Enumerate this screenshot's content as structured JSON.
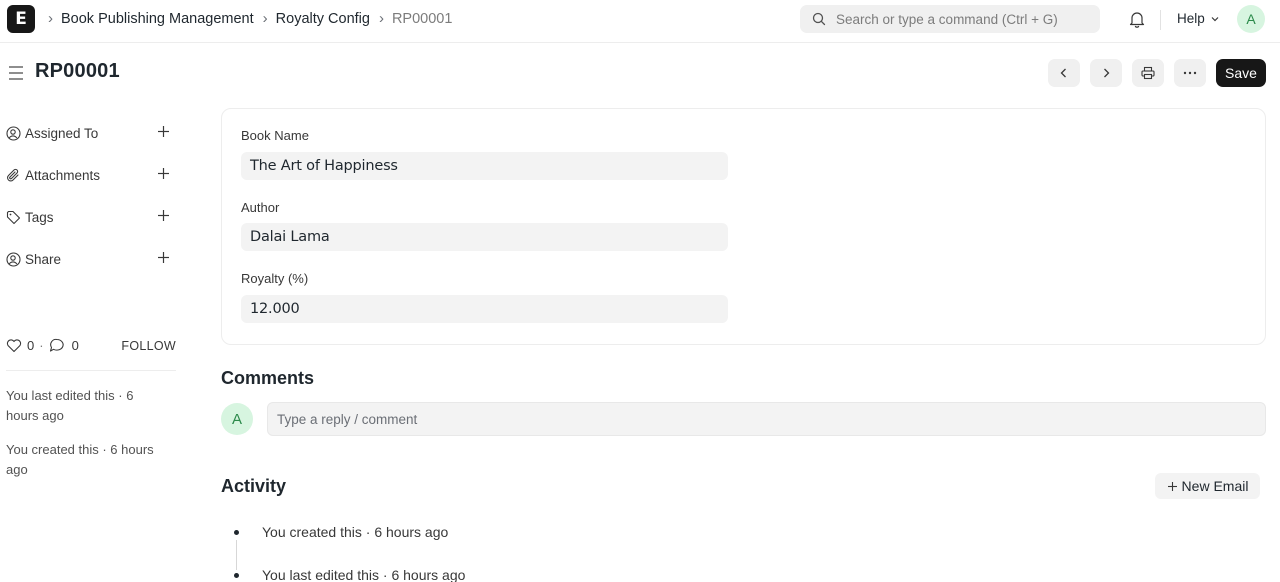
{
  "navbar": {
    "logo_letter": "E",
    "breadcrumbs": [
      "Book Publishing Management",
      "Royalty Config",
      "RP00001"
    ],
    "search_placeholder": "Search or type a command (Ctrl + G)",
    "help_label": "Help",
    "avatar_letter": "A"
  },
  "header": {
    "title": "RP00001",
    "save_label": "Save"
  },
  "sidebar": {
    "items": [
      {
        "label": "Assigned To"
      },
      {
        "label": "Attachments"
      },
      {
        "label": "Tags"
      },
      {
        "label": "Share"
      }
    ],
    "likes_count": "0",
    "comments_count": "0",
    "follow_label": "FOLLOW",
    "last_edited": "You last edited this · 6 hours ago",
    "created": "You created this · 6 hours ago"
  },
  "form": {
    "fields": [
      {
        "label": "Book Name",
        "value": "The Art of Happiness"
      },
      {
        "label": "Author",
        "value": "Dalai Lama"
      },
      {
        "label": "Royalty (%)",
        "value": "12.000"
      }
    ]
  },
  "comments": {
    "title": "Comments",
    "avatar_letter": "A",
    "placeholder": "Type a reply / comment"
  },
  "activity": {
    "title": "Activity",
    "new_email_label": "New Email",
    "items": [
      "You created this · 6 hours ago",
      "You last edited this · 6 hours ago"
    ]
  }
}
